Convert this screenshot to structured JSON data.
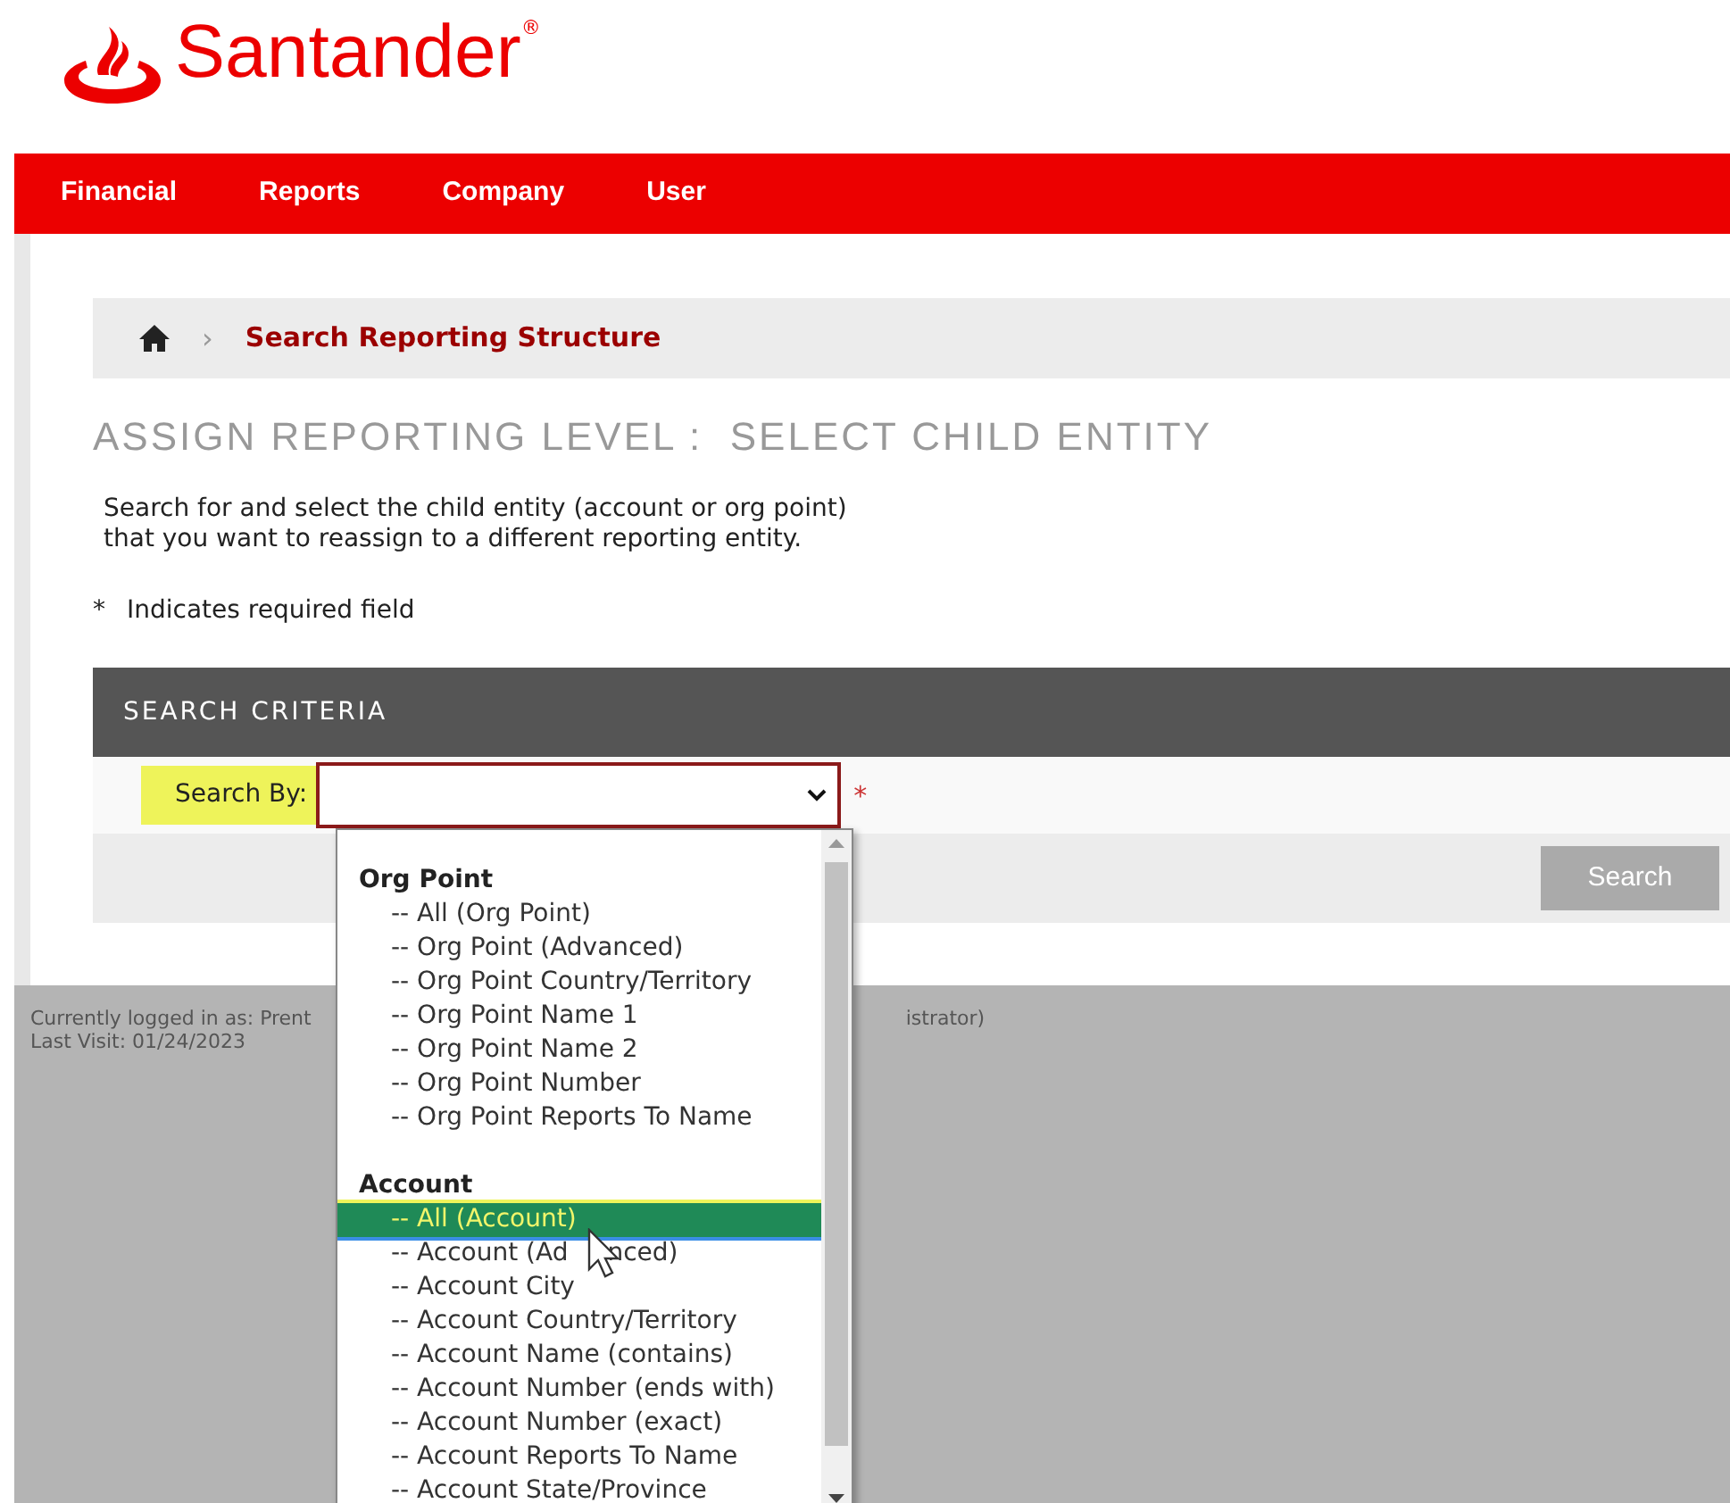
{
  "brand": {
    "name": "Santander",
    "mark": "®"
  },
  "nav": [
    {
      "label": "Financial"
    },
    {
      "label": "Reports"
    },
    {
      "label": "Company"
    },
    {
      "label": "User"
    }
  ],
  "breadcrumb": {
    "separator": "›",
    "current": "Search Reporting Structure"
  },
  "page_title": "ASSIGN REPORTING LEVEL :  SELECT CHILD ENTITY",
  "description": [
    "Search for and select the child entity (account or org point)",
    "that you want to reassign to a different reporting entity."
  ],
  "required_note": {
    "mark": "*",
    "text": "Indicates required field"
  },
  "search_criteria": {
    "title": "SEARCH CRITERIA",
    "label": "Search By:",
    "required_mark": "*",
    "button": "Search"
  },
  "dropdown": {
    "groups": [
      {
        "label": "Org Point",
        "options": [
          {
            "label": "-- All (Org Point)",
            "selected": false
          },
          {
            "label": "-- Org Point (Advanced)",
            "selected": false
          },
          {
            "label": "-- Org Point Country/Territory",
            "selected": false
          },
          {
            "label": "-- Org Point Name 1",
            "selected": false
          },
          {
            "label": "-- Org Point Name 2",
            "selected": false
          },
          {
            "label": "-- Org Point Number",
            "selected": false
          },
          {
            "label": "-- Org Point Reports To Name",
            "selected": false
          }
        ]
      },
      {
        "label": "Account",
        "options": [
          {
            "label": "-- All (Account)",
            "selected": true
          },
          {
            "label": "-- Account (Ad",
            "label_end": "nced)",
            "selected": false
          },
          {
            "label": "-- Account City",
            "selected": false
          },
          {
            "label": "-- Account Country/Territory",
            "selected": false
          },
          {
            "label": "-- Account Name (contains)",
            "selected": false
          },
          {
            "label": "-- Account Number (ends with)",
            "selected": false
          },
          {
            "label": "-- Account Number (exact)",
            "selected": false
          },
          {
            "label": "-- Account Reports To Name",
            "selected": false
          },
          {
            "label": "-- Account State/Province",
            "selected": false
          }
        ]
      }
    ]
  },
  "footer": {
    "login_start": "Currently logged in as: Prent",
    "login_end": "istrator)",
    "last_visit": "Last Visit: 01/24/2023"
  }
}
